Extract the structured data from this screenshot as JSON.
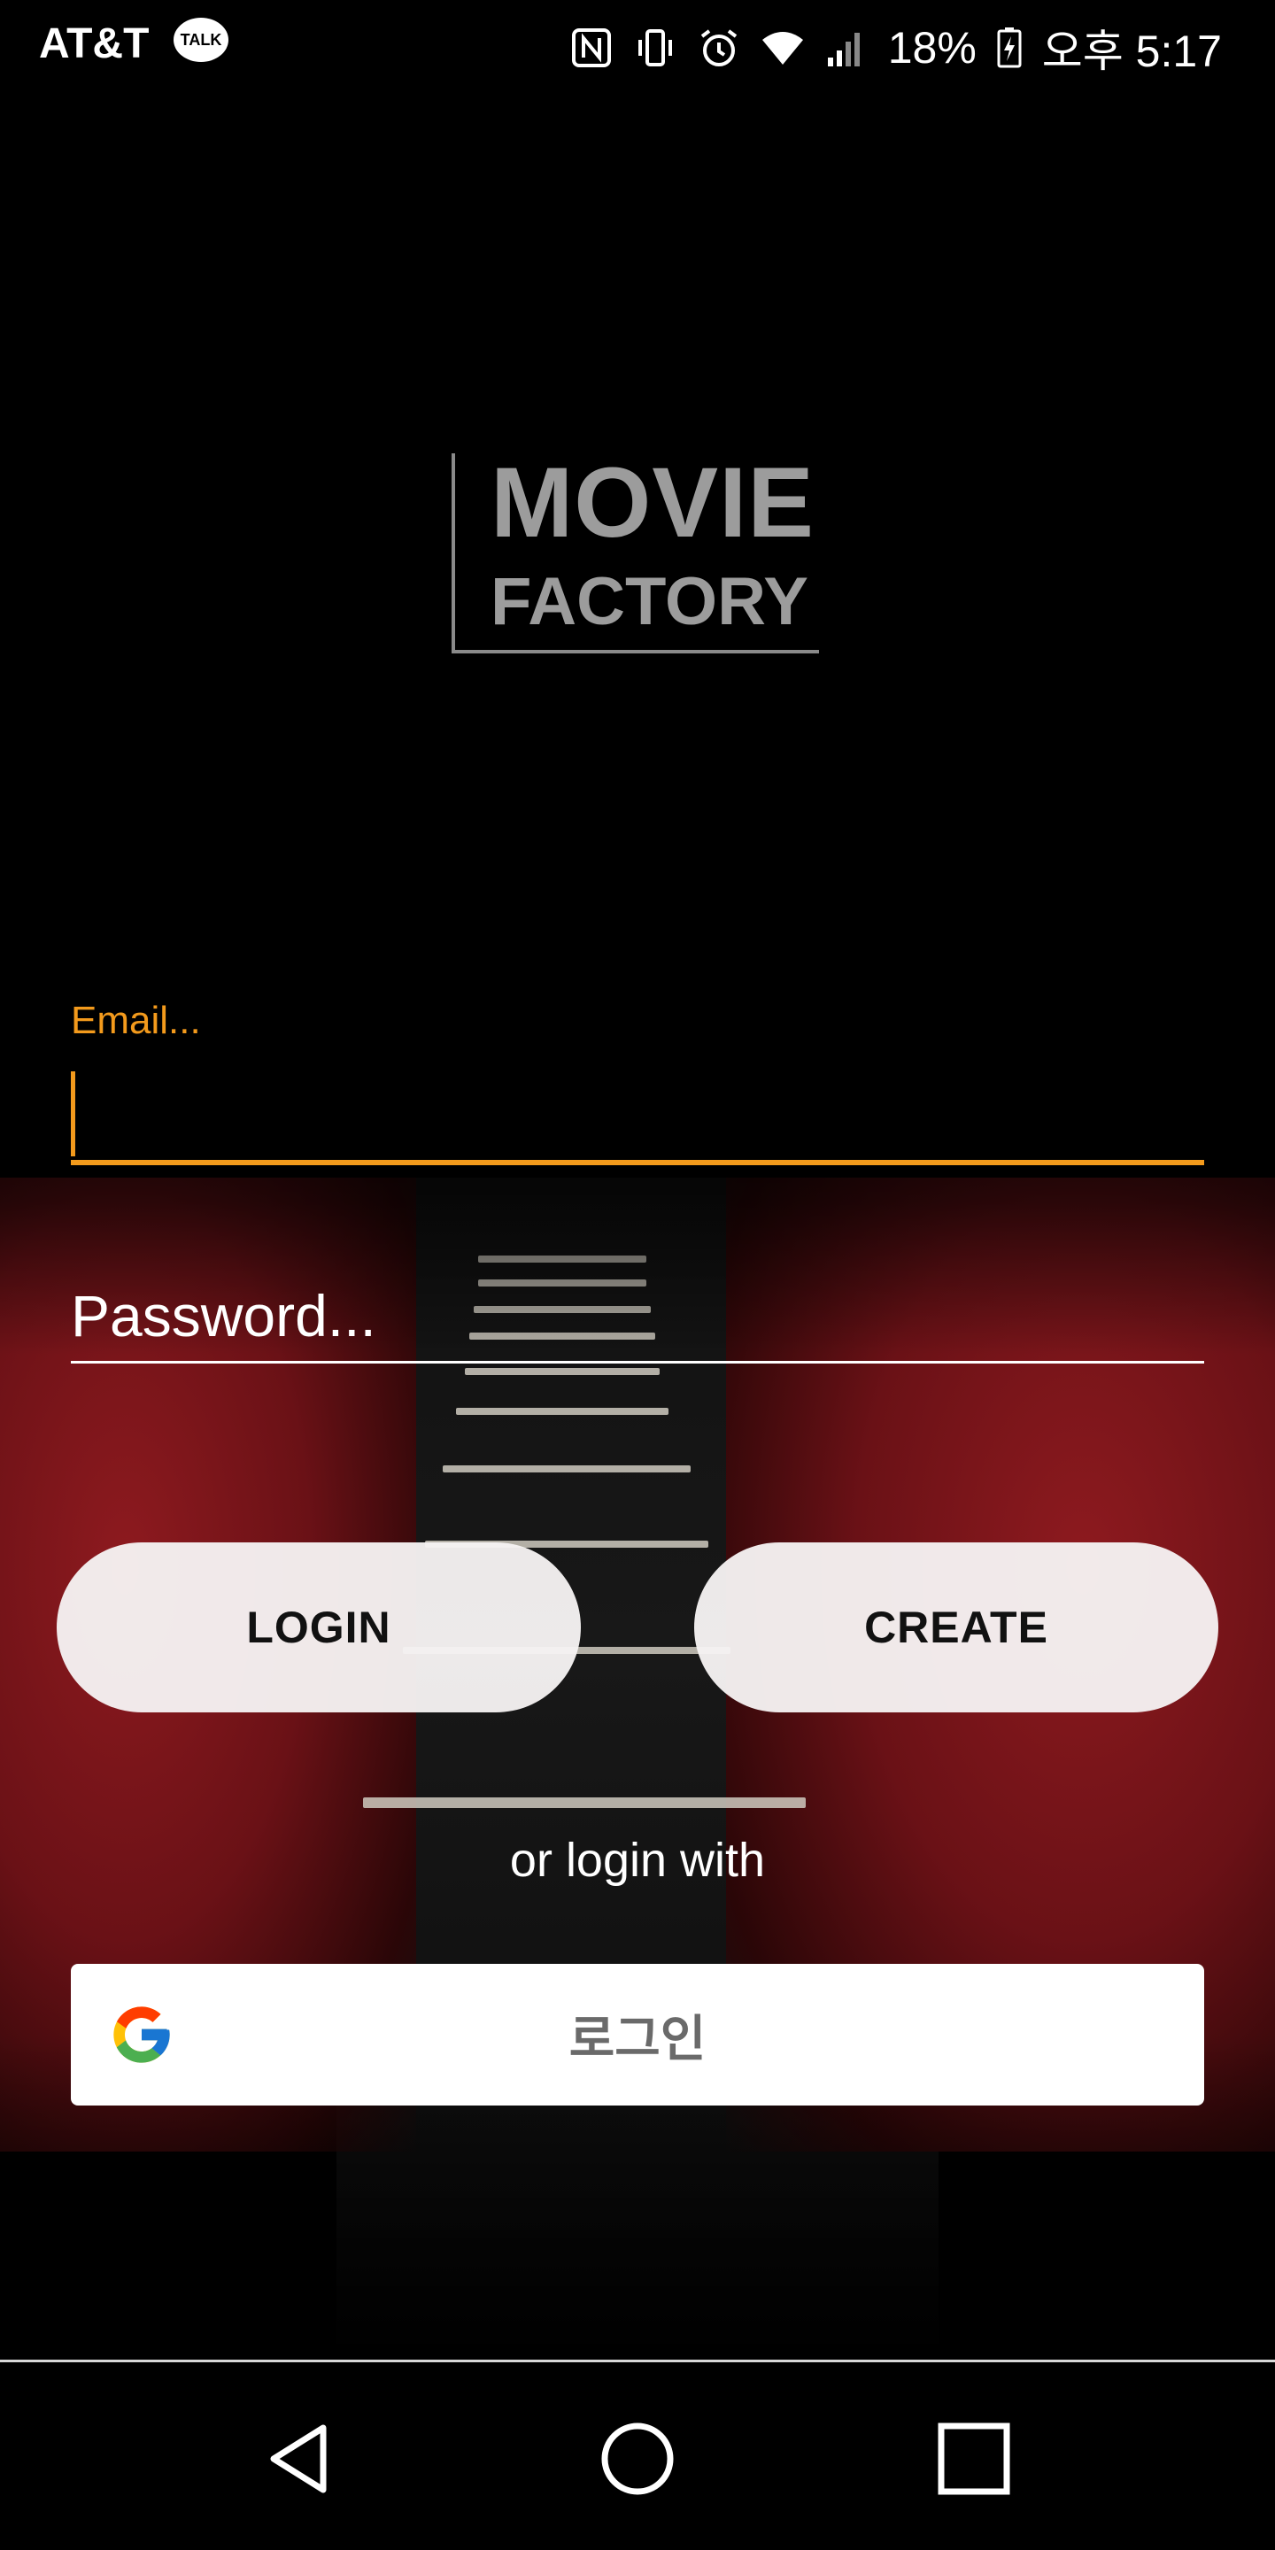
{
  "status_bar": {
    "carrier": "AT&T",
    "talk_badge": "TALK",
    "battery": "18%",
    "time": "오후 5:17"
  },
  "logo": {
    "line1": "MOVIE",
    "line2": "FACTORY"
  },
  "login_form": {
    "email_label": "Email...",
    "email_value": "",
    "password_placeholder": "Password...",
    "login_button": "LOGIN",
    "create_button": "CREATE",
    "or_text": "or login with",
    "google_button": "로그인"
  },
  "colors": {
    "accent": "#f39a1c",
    "background": "#000000",
    "button_bg": "#f6f2f2"
  },
  "icons": {
    "talk": "kakaotalk-icon",
    "nfc": "nfc-icon",
    "vibrate": "vibrate-icon",
    "alarm": "alarm-icon",
    "wifi": "wifi-icon",
    "signal": "signal-icon",
    "battery": "battery-charging-icon",
    "google": "google-g-icon",
    "back": "back-triangle-icon",
    "home": "home-circle-icon",
    "recent": "recent-square-icon"
  }
}
